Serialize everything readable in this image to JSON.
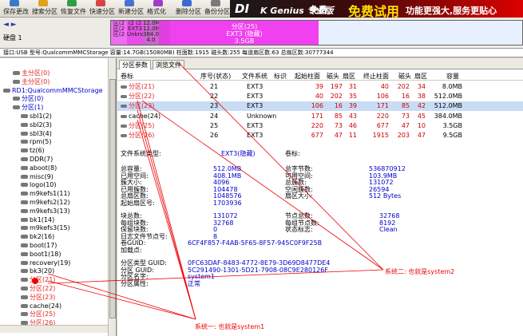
{
  "toolbar": {
    "buttons": [
      {
        "label": "保存更改",
        "icon": "save-icon",
        "color": "#3a78c8"
      },
      {
        "label": "搜索分区",
        "icon": "search-icon",
        "color": "#e0a020"
      },
      {
        "label": "恢复文件",
        "icon": "restore-icon",
        "color": "#2f9e44"
      },
      {
        "label": "快速分区",
        "icon": "quick-partition-icon",
        "color": "#d64545"
      },
      {
        "label": "新建分区",
        "icon": "new-partition-icon",
        "color": "#4a6fd0"
      },
      {
        "label": "格式化",
        "icon": "format-icon",
        "color": "#a23ac8"
      },
      {
        "label": "删除分区",
        "icon": "delete-icon",
        "color": "#3a6ad0"
      },
      {
        "label": "备份分区",
        "icon": "backup-icon",
        "color": "#7a7a7a"
      }
    ],
    "banner": {
      "brand": "DI",
      "brand2": "K Genius 专业版",
      "tag1": "免费",
      "slogan": "免费试用",
      "slogan2": "功能更强大,服务更贴心"
    }
  },
  "disk": {
    "nav": "◄ ►",
    "label": "硬盘 1",
    "segments": [
      {
        "text": "区(2 区(2 区(2",
        "color": "#f06cf0"
      },
      {
        "text": "(2 (2 EXT3 Unkno",
        "color": "#e84ee8"
      },
      {
        "text": "12.0M 12.0M 384.0M 4.0",
        "color": "#cc66cc"
      },
      {
        "text": "分区(25)",
        "color": "#e040e0"
      }
    ],
    "big_segment": {
      "title": "分区(25)",
      "fs": "EXT3 (隐藏)",
      "size": "3.5GB"
    }
  },
  "infobar": "接口:USB  型号:QualcommMMCStorage  容量:14.7GB(15080MB)  柱面数:1915  磁头数:255  每道扇区数:63  总扇区数:30777344",
  "tree": [
    {
      "label": "主分区(0)",
      "cls": "red",
      "indent": 16
    },
    {
      "label": "主分区(0)",
      "cls": "red",
      "indent": 16
    },
    {
      "label": "RD1:QualcommMMCStorage",
      "cls": "blue",
      "indent": 4
    },
    {
      "label": "分区(0)",
      "cls": "blue",
      "indent": 16
    },
    {
      "label": "分区(1)",
      "cls": "blue",
      "indent": 16
    },
    {
      "label": "sbl1(2)",
      "cls": "",
      "indent": 26
    },
    {
      "label": "sbl2(3)",
      "cls": "",
      "indent": 26
    },
    {
      "label": "sbl3(4)",
      "cls": "",
      "indent": 26
    },
    {
      "label": "rpm(5)",
      "cls": "",
      "indent": 26
    },
    {
      "label": "tz(6)",
      "cls": "",
      "indent": 26
    },
    {
      "label": "DDR(7)",
      "cls": "",
      "indent": 26
    },
    {
      "label": "aboot(8)",
      "cls": "",
      "indent": 26
    },
    {
      "label": "misc(9)",
      "cls": "",
      "indent": 26
    },
    {
      "label": "logo(10)",
      "cls": "",
      "indent": 26
    },
    {
      "label": "m9kefs1(11)",
      "cls": "",
      "indent": 26
    },
    {
      "label": "m9kefs2(12)",
      "cls": "",
      "indent": 26
    },
    {
      "label": "m9kefs3(13)",
      "cls": "",
      "indent": 26
    },
    {
      "label": "bk1(14)",
      "cls": "",
      "indent": 26
    },
    {
      "label": "m9kefs3(15)",
      "cls": "",
      "indent": 26
    },
    {
      "label": "bk2(16)",
      "cls": "",
      "indent": 26
    },
    {
      "label": "boot(17)",
      "cls": "",
      "indent": 26
    },
    {
      "label": "boot1(18)",
      "cls": "",
      "indent": 26
    },
    {
      "label": "recovery(19)",
      "cls": "",
      "indent": 26
    },
    {
      "label": "bk3(20)",
      "cls": "",
      "indent": 26
    },
    {
      "label": "分区(21)",
      "cls": "red",
      "indent": 26
    },
    {
      "label": "分区(22)",
      "cls": "red",
      "indent": 26
    },
    {
      "label": "分区(23)",
      "cls": "red",
      "indent": 26
    },
    {
      "label": "cache(24)",
      "cls": "",
      "indent": 26
    },
    {
      "label": "分区(25)",
      "cls": "red",
      "indent": 26
    },
    {
      "label": "分区(26)",
      "cls": "red",
      "indent": 26
    }
  ],
  "tabs": [
    "分区参数",
    "浏览文件"
  ],
  "table": {
    "headers": [
      "卷标",
      "序号(状态)",
      "文件系统",
      "标识",
      "起始柱面",
      "磁头",
      "扇区",
      "终止柱面",
      "磁头",
      "扇区",
      "容量"
    ],
    "rows": [
      {
        "name": "分区(21)",
        "cls": "red",
        "num": "21",
        "fs": "EXT3",
        "flag": "",
        "c1": "39",
        "h1": "197",
        "s1": "31",
        "c2": "40",
        "h2": "202",
        "s2": "34",
        "size": "8.0MB"
      },
      {
        "name": "分区(22)",
        "cls": "red",
        "num": "22",
        "fs": "EXT3",
        "flag": "",
        "c1": "40",
        "h1": "202",
        "s1": "35",
        "c2": "106",
        "h2": "16",
        "s2": "38",
        "size": "512.0MB"
      },
      {
        "name": "分区(23)",
        "cls": "red",
        "num": "23",
        "fs": "EXT3",
        "flag": "",
        "c1": "106",
        "h1": "16",
        "s1": "39",
        "c2": "171",
        "h2": "85",
        "s2": "42",
        "size": "512.0MB"
      },
      {
        "name": "cache(24)",
        "cls": "",
        "num": "24",
        "fs": "Unknown",
        "flag": "",
        "c1": "171",
        "h1": "85",
        "s1": "43",
        "c2": "220",
        "h2": "73",
        "s2": "45",
        "size": "384.0MB"
      },
      {
        "name": "分区(25)",
        "cls": "red",
        "num": "25",
        "fs": "EXT3",
        "flag": "",
        "c1": "220",
        "h1": "73",
        "s1": "46",
        "c2": "677",
        "h2": "47",
        "s2": "10",
        "size": "3.5GB"
      },
      {
        "name": "分区(26)",
        "cls": "red",
        "num": "26",
        "fs": "EXT3",
        "flag": "",
        "c1": "677",
        "h1": "47",
        "s1": "11",
        "c2": "1915",
        "h2": "203",
        "s2": "47",
        "size": "9.5GB"
      }
    ]
  },
  "details": {
    "fs_type_label": "文件系统类型:",
    "fs_type_value": "EXT3(隐藏)",
    "vol_label": "卷标:",
    "left1": [
      {
        "k": "总容量:",
        "v": "512.0MB"
      },
      {
        "k": "已用空间:",
        "v": "408.1MB"
      },
      {
        "k": "簇大小:",
        "v": "4096"
      },
      {
        "k": "已用簇数:",
        "v": "104478"
      },
      {
        "k": "总扇区数:",
        "v": "1048576"
      },
      {
        "k": "起始扇区号:",
        "v": "1703936"
      }
    ],
    "right1": [
      {
        "k": "总字节数:",
        "v": "536870912"
      },
      {
        "k": "可用空间:",
        "v": "103.9MB"
      },
      {
        "k": "总簇数:",
        "v": "131072"
      },
      {
        "k": "空闲簇数:",
        "v": "26594"
      },
      {
        "k": "扇区大小:",
        "v": "512 Bytes"
      }
    ],
    "left2": [
      {
        "k": "块总数:",
        "v": "131072"
      },
      {
        "k": "每组块数:",
        "v": "32768"
      },
      {
        "k": "保留块数:",
        "v": "0"
      },
      {
        "k": "日志文件节点号:",
        "v": "8"
      },
      {
        "k": "卷GUID:",
        "v": "6CF4F857-F4AB-5F65-8F57-945C0F9F25B"
      },
      {
        "k": "加载点:",
        "v": ""
      }
    ],
    "right2": [
      {
        "k": "节点总数:",
        "v": "32768"
      },
      {
        "k": "每组节点数:",
        "v": "8192"
      },
      {
        "k": "状态标志:",
        "v": "Clean"
      }
    ],
    "guid": [
      {
        "k": "分区类型 GUID:",
        "v": "0FC63DAF-8483-4772-8E79-3D69D8477DE4"
      },
      {
        "k": "分区 GUID:",
        "v": "5C291490-1301-5D21-7908-08C9E280126F"
      },
      {
        "k": "分区名字:",
        "v": "system1"
      },
      {
        "k": "分区属性:",
        "v": "正常"
      }
    ]
  },
  "annotations": {
    "a1": "系统二: 也就是system2",
    "a2": "系统一: 也就是system1"
  }
}
